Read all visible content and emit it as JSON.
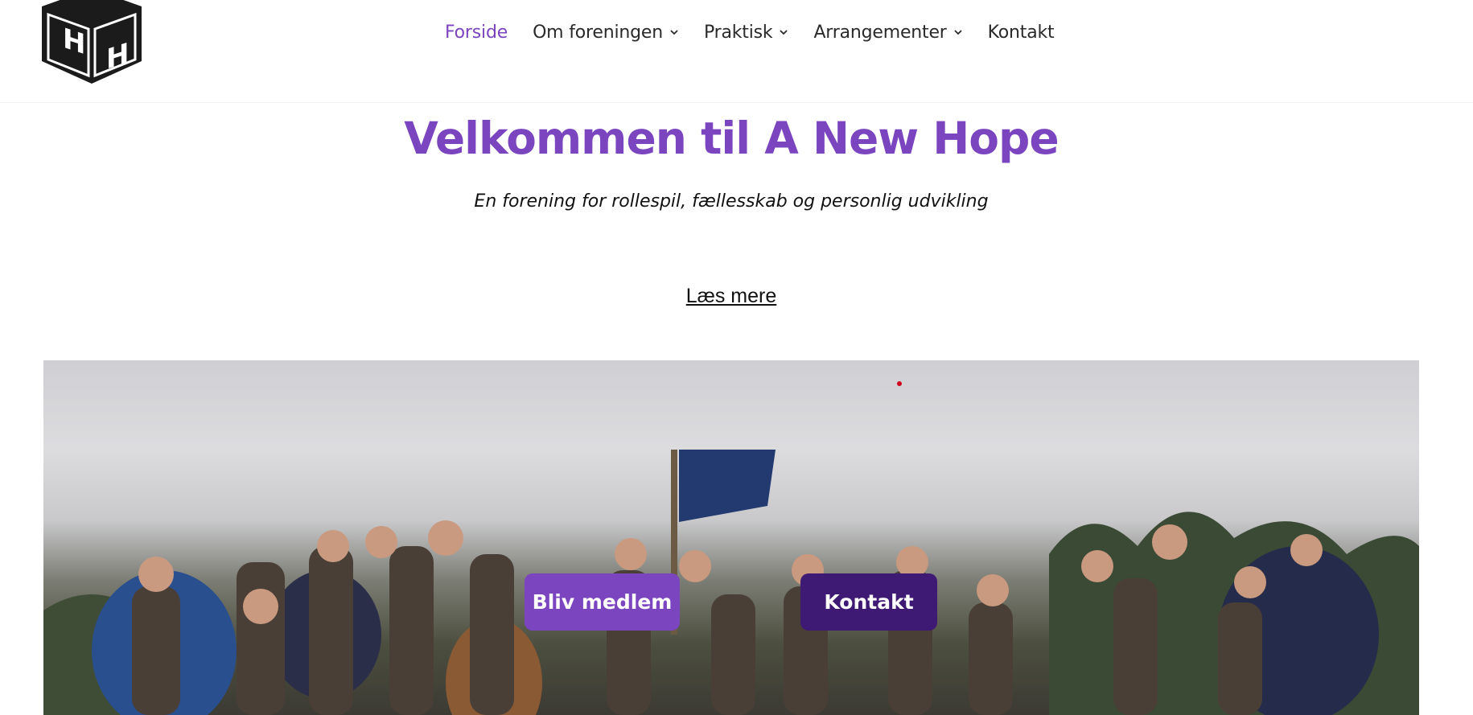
{
  "header": {
    "logo_icon": "cube-logo-icon",
    "nav": [
      {
        "label": "Forside",
        "active": true,
        "has_dropdown": false
      },
      {
        "label": "Om foreningen",
        "active": false,
        "has_dropdown": true
      },
      {
        "label": "Praktisk",
        "active": false,
        "has_dropdown": true
      },
      {
        "label": "Arrangementer",
        "active": false,
        "has_dropdown": true
      },
      {
        "label": "Kontakt",
        "active": false,
        "has_dropdown": false
      }
    ]
  },
  "hero": {
    "title": "Velkommen til A New Hope",
    "subtitle": "En forening for rollespil, fællesskab og personlig udvikling",
    "read_more": "Læs mere"
  },
  "photo": {
    "description_icon": "group-photo-image",
    "buttons": {
      "primary": "Bliv medlem",
      "secondary": "Kontakt"
    }
  },
  "colors": {
    "accent": "#7b45c0",
    "dark_accent": "#3f1a75",
    "text": "#2a2a2a"
  }
}
